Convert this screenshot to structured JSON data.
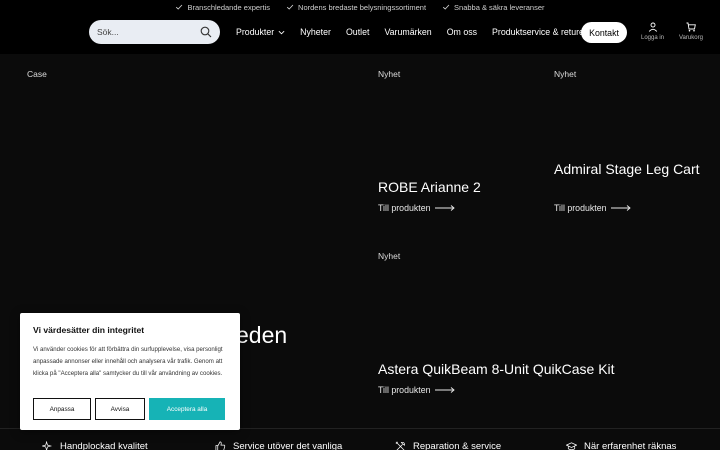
{
  "usp_bar": {
    "items": [
      "Branschledande expertis",
      "Nordens bredaste belysningssortiment",
      "Snabba & säkra leveranser"
    ]
  },
  "header": {
    "search_placeholder": "Sök...",
    "nav": [
      "Produkter",
      "Nyheter",
      "Outlet",
      "Varumärken",
      "Om oss",
      "Produktservice & returer"
    ],
    "contact_label": "Kontakt",
    "login_label": "Logga in",
    "cart_label": "Varukorg"
  },
  "main": {
    "case_label": "Case",
    "hero_partial_text": "eden",
    "cards": [
      {
        "badge": "Nyhet",
        "title": "ROBE Arianne 2",
        "link": "Till produkten"
      },
      {
        "badge": "Nyhet",
        "title": "Admiral Stage Leg Cart",
        "link": "Till produkten"
      },
      {
        "badge": "Nyhet",
        "title": "Astera QuikBeam 8-Unit QuikCase Kit",
        "link": "Till produkten"
      }
    ]
  },
  "features": [
    "Handplockad kvalitet",
    "Service utöver det vanliga",
    "Reparation & service",
    "När erfarenhet räknas"
  ],
  "cookie": {
    "title": "Vi värdesätter din integritet",
    "text": "Vi använder cookies för att förbättra din surfupplevelse, visa personligt anpassade annonser eller innehåll och analysera vår trafik. Genom att klicka på \"Acceptera alla\" samtycker du till vår användning av cookies.",
    "customize": "Anpassa",
    "reject": "Avvisa",
    "accept": "Acceptera alla"
  },
  "colors": {
    "accent": "#16b3b6",
    "background": "#0b0b0b"
  }
}
